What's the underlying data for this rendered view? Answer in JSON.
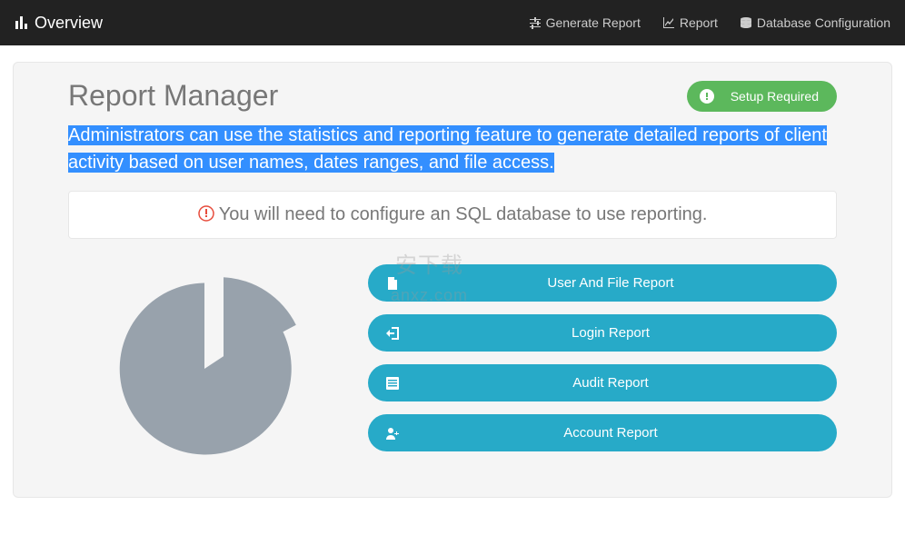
{
  "topbar": {
    "brand": "Overview",
    "links": {
      "generate": "Generate Report",
      "report": "Report",
      "database": "Database Configuration"
    }
  },
  "page": {
    "title": "Report Manager",
    "setup_label": "Setup Required",
    "lead": "Administrators can use the statistics and reporting feature to generate detailed reports of client activity based on user names, dates ranges, and file access.",
    "warning": " You will need to configure an SQL database to use reporting."
  },
  "actions": {
    "user_file": "User And File Report",
    "login": "Login Report",
    "audit": "Audit Report",
    "account": "Account Report"
  },
  "watermark": {
    "line1": "安下载",
    "line2": "anxz.com"
  }
}
